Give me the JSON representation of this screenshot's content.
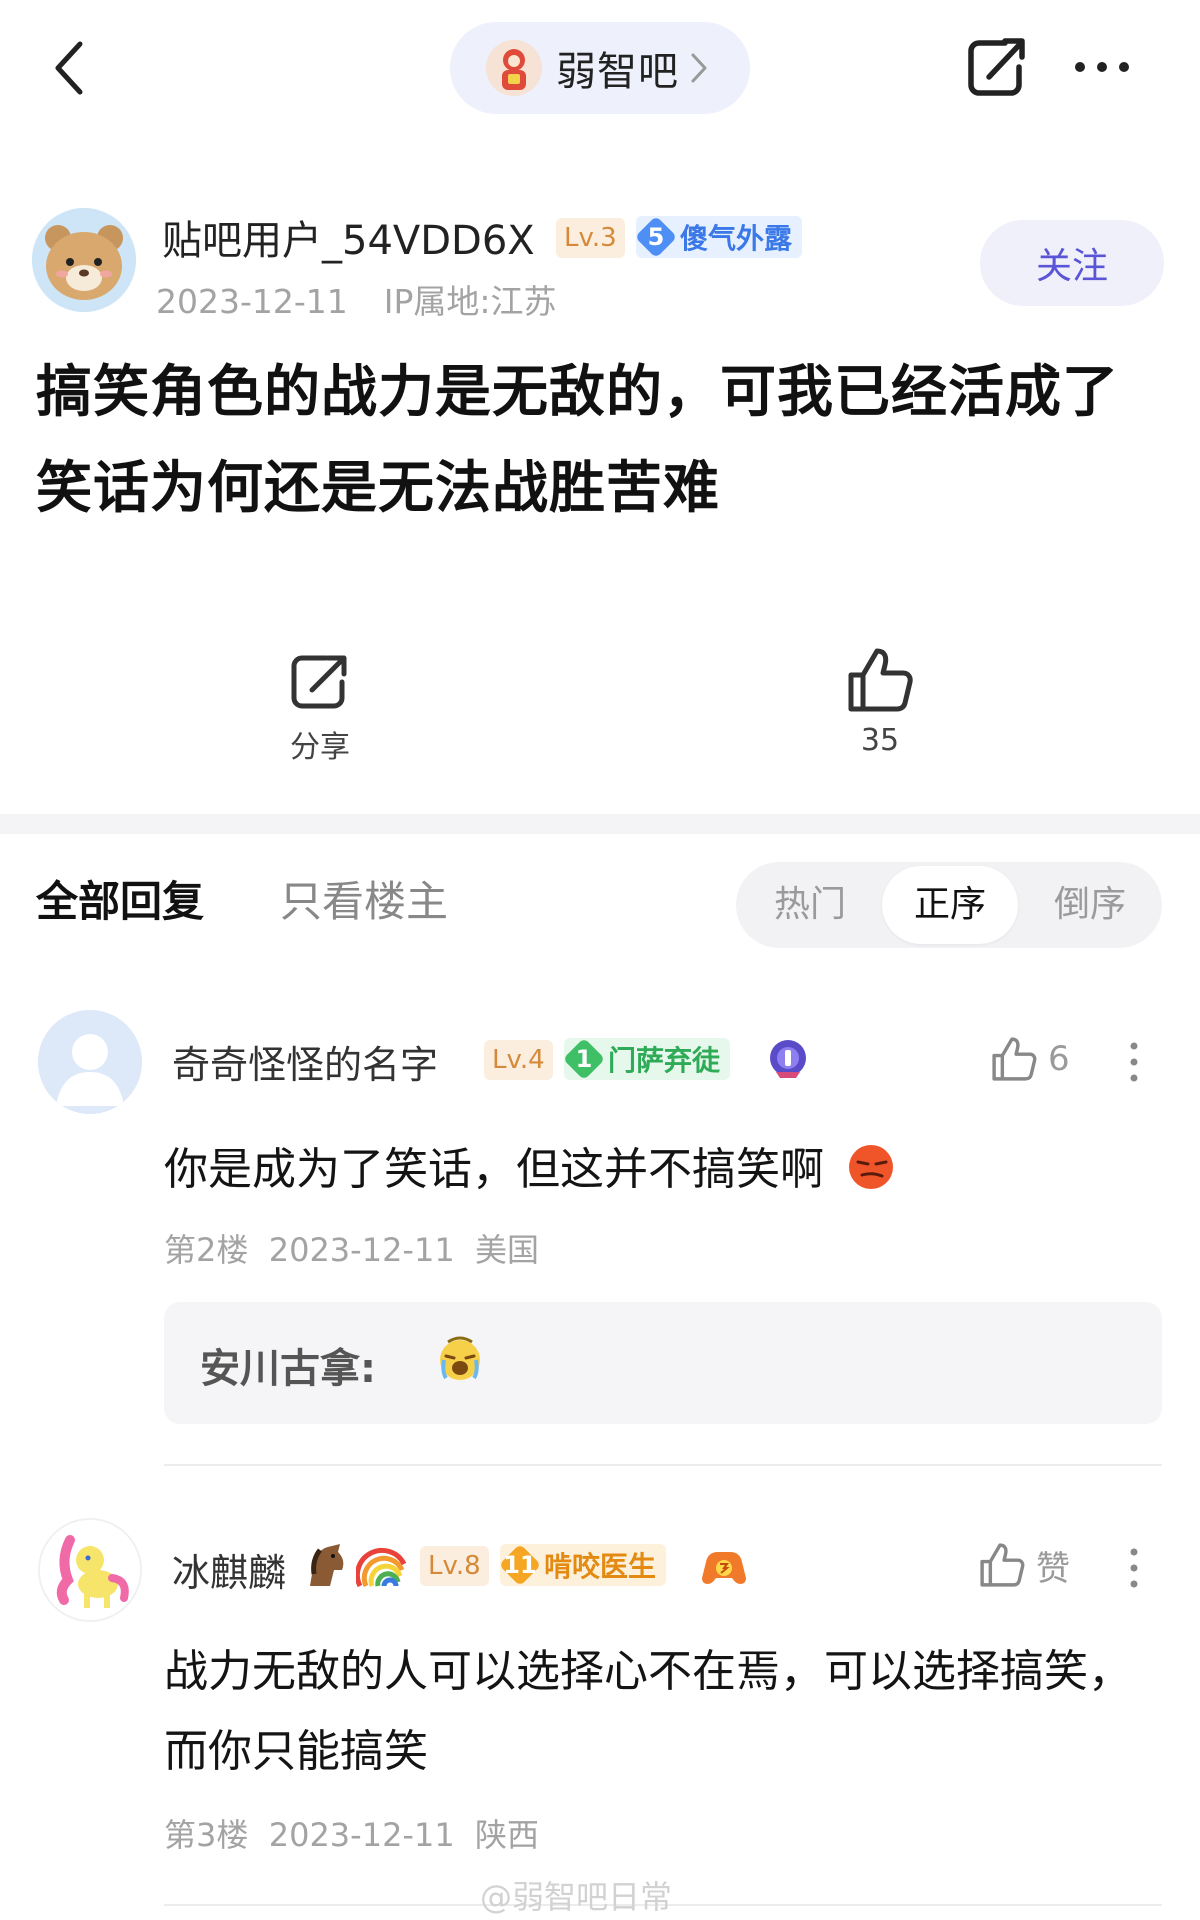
{
  "topbar": {
    "forum_name": "弱智吧",
    "icons": {
      "back": "chevron-left-icon",
      "share": "share-icon",
      "more": "more-dots-icon"
    }
  },
  "post": {
    "author": {
      "name": "贴吧用户_54VDD6X",
      "level": "Lv.3",
      "badge_level": "5",
      "badge_name": "傻气外露",
      "date": "2023-12-11",
      "ip": "IP属地:江苏"
    },
    "follow_label": "关注",
    "title": "搞笑角色的战力是无敌的，可我已经活成了笑话为何还是无法战胜苦难",
    "share_label": "分享",
    "like_count": "35"
  },
  "tabs": {
    "all": "全部回复",
    "op_only": "只看楼主",
    "sort": {
      "hot": "热门",
      "asc": "正序",
      "desc": "倒序",
      "selected": "正序"
    }
  },
  "replies": [
    {
      "name": "奇奇怪怪的名字",
      "level": "Lv.4",
      "badge_level": "1",
      "badge_name": "门萨弃徒",
      "likes": "6",
      "body": "你是成为了笑话，但这并不搞笑啊",
      "floor": "第2楼",
      "date": "2023-12-11",
      "location": "美国",
      "sub_reply": {
        "author": "安川古拿:"
      }
    },
    {
      "name": "冰麒麟",
      "level": "Lv.8",
      "badge_level": "11",
      "badge_name": "啃咬医生",
      "likes": "赞",
      "body": "战力无敌的人可以选择心不在焉，可以选择搞笑，而你只能搞笑",
      "floor": "第3楼",
      "date": "2023-12-11",
      "location": "陕西"
    }
  ],
  "watermark": "@弱智吧日常",
  "colors": {
    "accent": "#5a55d6",
    "level_bg": "#fbeede",
    "level_fg": "#d48a3a",
    "pill_bg": "#eef1fb"
  }
}
